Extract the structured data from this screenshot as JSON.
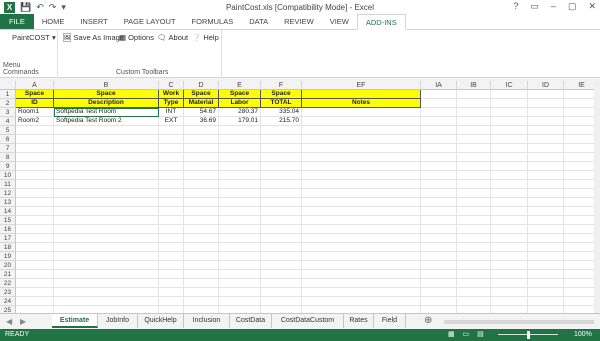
{
  "window": {
    "title": "PaintCost.xls  [Compatibility Mode] - Excel",
    "controls": [
      "?",
      "▭",
      "–",
      "▢",
      "✕"
    ]
  },
  "ribbon_tabs": [
    "FILE",
    "HOME",
    "INSERT",
    "PAGE LAYOUT",
    "FORMULAS",
    "DATA",
    "REVIEW",
    "VIEW",
    "ADD-INS"
  ],
  "ribbon": {
    "menu_button": "PaintCOST",
    "menu_group_label": "Menu Commands",
    "save_image": "Save As Image",
    "options": "Options",
    "about": "About",
    "help": "Help",
    "toolbar_group_label": "Custom Toolbars"
  },
  "columns": [
    "A",
    "B",
    "C",
    "D",
    "E",
    "F",
    "EF",
    "IA",
    "IB",
    "IC",
    "ID",
    "IE"
  ],
  "row_numbers": [
    "1",
    "2",
    "3",
    "4",
    "5",
    "6",
    "7",
    "8",
    "9",
    "10",
    "11",
    "12",
    "13",
    "14",
    "15",
    "16",
    "17",
    "18",
    "19",
    "20",
    "21",
    "22",
    "23",
    "24",
    "25"
  ],
  "header_row1": [
    "Space",
    "Space",
    "Work",
    "Space",
    "Space",
    "Space",
    ""
  ],
  "header_row2": [
    "ID",
    "Description",
    "Type",
    "Material",
    "Labor",
    "TOTAL",
    "Notes"
  ],
  "rows": [
    [
      "Room1",
      "Softpedia Test Room",
      "INT",
      "54.67",
      "280.37",
      "335.04",
      ""
    ],
    [
      "Room2",
      "Softpedia Test Room 2",
      "EXT",
      "36.69",
      "179.01",
      "215.70",
      ""
    ]
  ],
  "sheet_tabs": [
    "Estimate",
    "JobInfo",
    "QuickHelp",
    "Inclusion",
    "CostData",
    "CostDataCustom",
    "Rates",
    "Field"
  ],
  "status": {
    "ready": "READY",
    "zoom": "100%"
  }
}
